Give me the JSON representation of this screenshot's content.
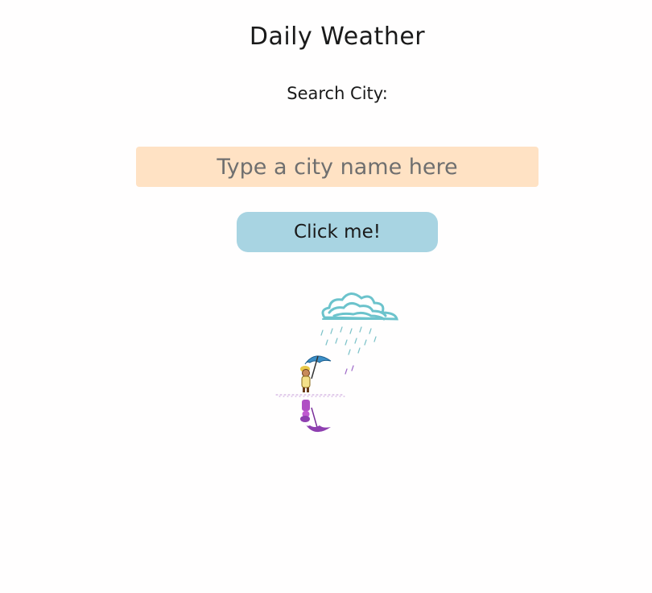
{
  "page": {
    "title": "Daily Weather"
  },
  "search": {
    "label": "Search City:",
    "placeholder": "Type a city name here",
    "value": ""
  },
  "actions": {
    "submit_label": "Click me!"
  },
  "illustration": {
    "icon": "rain-cloud-umbrella-person-icon"
  },
  "colors": {
    "input_background": "#ffe2c4",
    "button_background": "#a8d4e2",
    "cloud": "#6cc3cc",
    "umbrella": "#3b8fc7",
    "reflection": "#8e3fb0"
  }
}
